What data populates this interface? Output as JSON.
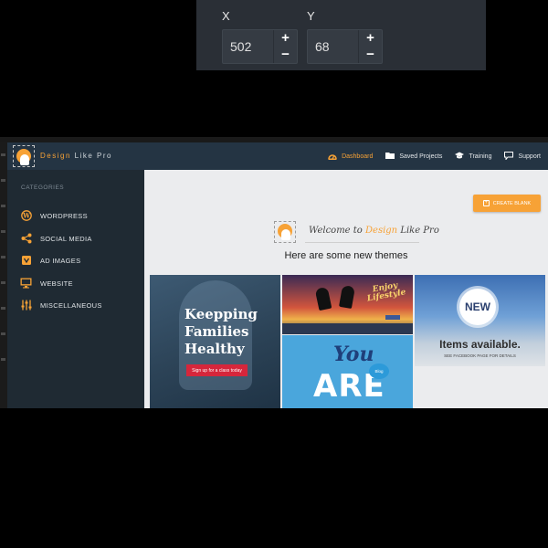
{
  "xy_panel": {
    "x_label": "X",
    "y_label": "Y",
    "x_value": "502",
    "y_value": "68",
    "increment_symbol": "+",
    "decrement_symbol": "−"
  },
  "header": {
    "brand_prefix": "Design",
    "brand_suffix": "Like Pro",
    "nav": [
      {
        "label": "Dashboard",
        "icon": "dashboard-icon",
        "active": true
      },
      {
        "label": "Saved Projects",
        "icon": "folder-icon",
        "active": false
      },
      {
        "label": "Training",
        "icon": "graduation-cap-icon",
        "active": false
      },
      {
        "label": "Support",
        "icon": "chat-icon",
        "active": false
      }
    ]
  },
  "sidebar": {
    "heading": "CATEGORIES",
    "items": [
      {
        "label": "WORDPRESS",
        "icon": "wordpress-icon"
      },
      {
        "label": "SOCIAL MEDIA",
        "icon": "share-icon"
      },
      {
        "label": "AD IMAGES",
        "icon": "ad-badge-icon"
      },
      {
        "label": "WEBSITE",
        "icon": "monitor-icon"
      },
      {
        "label": "MISCELLANEOUS",
        "icon": "sliders-icon"
      }
    ]
  },
  "main": {
    "create_blank_label": "CREATE BLANK",
    "welcome_prefix": "Welcome to",
    "welcome_brand": "Design",
    "welcome_suffix": "Like Pro",
    "themes_heading": "Here are some new themes",
    "themes": {
      "families": {
        "line1": "Keepping",
        "line2": "Families",
        "line3": "Healthy",
        "cta": "Sign up for a class today"
      },
      "lifestyle": {
        "line1": "Enjoy",
        "line2": "Lifestyle"
      },
      "you_are": {
        "line1": "You",
        "line2": "ARE",
        "bubble": "Blog"
      },
      "new_items": {
        "badge": "NEW",
        "headline": "Items available.",
        "subline": "SEE FACEBOOK PAGE FOR DETAILS"
      }
    }
  },
  "colors": {
    "accent": "#f7a236",
    "topbar": "#243443",
    "sidebar": "#1f2a33",
    "main_bg": "#ebecee"
  }
}
